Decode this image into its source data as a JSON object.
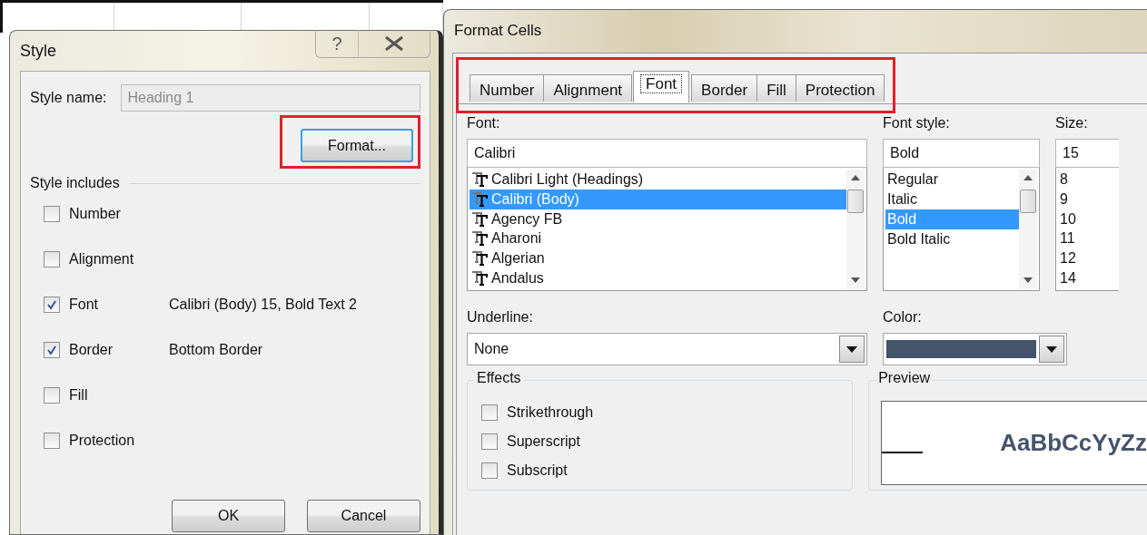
{
  "style_dialog": {
    "title": "Style",
    "help_button": "?",
    "style_name": {
      "label": "Style name:",
      "value": "Heading 1",
      "disabled": true
    },
    "format_button": "Format...",
    "includes_heading": "Style includes",
    "includes": [
      {
        "label": "Number",
        "checked": false
      },
      {
        "label": "Alignment",
        "checked": false
      },
      {
        "label": "Font",
        "checked": true,
        "description": "Calibri (Body) 15, Bold Text 2"
      },
      {
        "label": "Border",
        "checked": true,
        "description": "Bottom Border"
      },
      {
        "label": "Fill",
        "checked": false
      },
      {
        "label": "Protection",
        "checked": false
      }
    ],
    "buttons": [
      "OK",
      "Cancel"
    ]
  },
  "format_dialog": {
    "title": "Format Cells",
    "tabs": [
      {
        "label": "Number",
        "selected": false
      },
      {
        "label": "Alignment",
        "selected": false
      },
      {
        "label": "Font",
        "selected": true
      },
      {
        "label": "Border",
        "selected": false
      },
      {
        "label": "Fill",
        "selected": false
      },
      {
        "label": "Protection",
        "selected": false
      }
    ],
    "font": {
      "label": "Font:",
      "value": "Calibri",
      "items": [
        {
          "label": "Calibri Light (Headings)",
          "selected": false
        },
        {
          "label": "Calibri (Body)",
          "selected": true
        },
        {
          "label": "Agency FB",
          "selected": false
        },
        {
          "label": "Aharoni",
          "selected": false
        },
        {
          "label": "Algerian",
          "selected": false
        },
        {
          "label": "Andalus",
          "selected": false
        }
      ]
    },
    "font_style": {
      "label": "Font style:",
      "value": "Bold",
      "items": [
        {
          "label": "Regular",
          "selected": false
        },
        {
          "label": "Italic",
          "selected": false
        },
        {
          "label": "Bold",
          "selected": true
        },
        {
          "label": "Bold Italic",
          "selected": false
        }
      ]
    },
    "size": {
      "label": "Size:",
      "value": "15",
      "items": [
        "8",
        "9",
        "10",
        "11",
        "12",
        "14"
      ]
    },
    "underline": {
      "label": "Underline:",
      "value": "None"
    },
    "color": {
      "label": "Color:",
      "color": "#44546a"
    },
    "effects": {
      "title": "Effects",
      "items": [
        {
          "label": "Strikethrough",
          "checked": false
        },
        {
          "label": "Superscript",
          "checked": false
        },
        {
          "label": "Subscript",
          "checked": false
        }
      ]
    },
    "preview": {
      "title": "Preview",
      "sample": "AaBbCcYyZz"
    }
  }
}
